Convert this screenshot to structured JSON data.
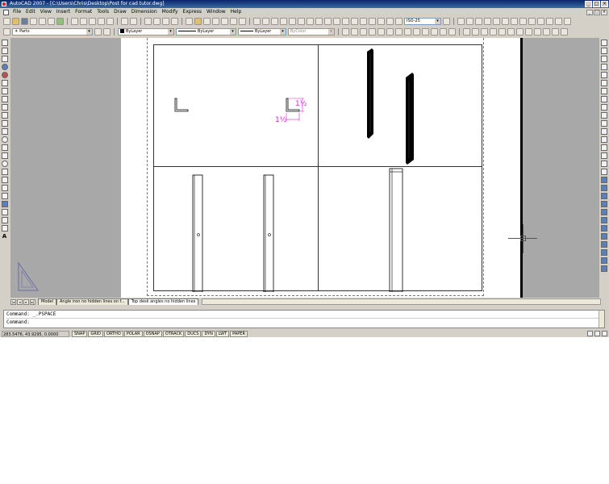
{
  "window": {
    "title": "AutoCAD 2007 - [C:\\Users\\Chris\\Desktop\\Post for cad tutor.dwg]"
  },
  "menu": {
    "items": [
      "File",
      "Edit",
      "View",
      "Insert",
      "Format",
      "Tools",
      "Draw",
      "Dimension",
      "Modify",
      "Express",
      "Window",
      "Help"
    ]
  },
  "toolbar": {
    "layer": "Parts",
    "color": "ByLayer",
    "linetype": "ByLayer",
    "lineweight": "ByLayer",
    "plotstyle": "ByColor",
    "dimstyle": "ISO-25"
  },
  "tabs": {
    "items": [
      "Model",
      "Angle iron no hidden lines on f...",
      "Top desk angles no hidden lines"
    ],
    "active_index": 2
  },
  "command": {
    "history": "Command:  _.PSPACE",
    "prompt": "Command:"
  },
  "status": {
    "coordinates": "283.5476, 43.9295, 0.0000",
    "buttons": [
      "SNAP",
      "GRID",
      "ORTHO",
      "POLAR",
      "OSNAP",
      "OTRACK",
      "DUCS",
      "DYN",
      "LWT",
      "PAPER"
    ]
  },
  "drawing": {
    "dimension_vertical": "1½",
    "dimension_horizontal": "1½",
    "dimension_color": "#e020e0"
  }
}
